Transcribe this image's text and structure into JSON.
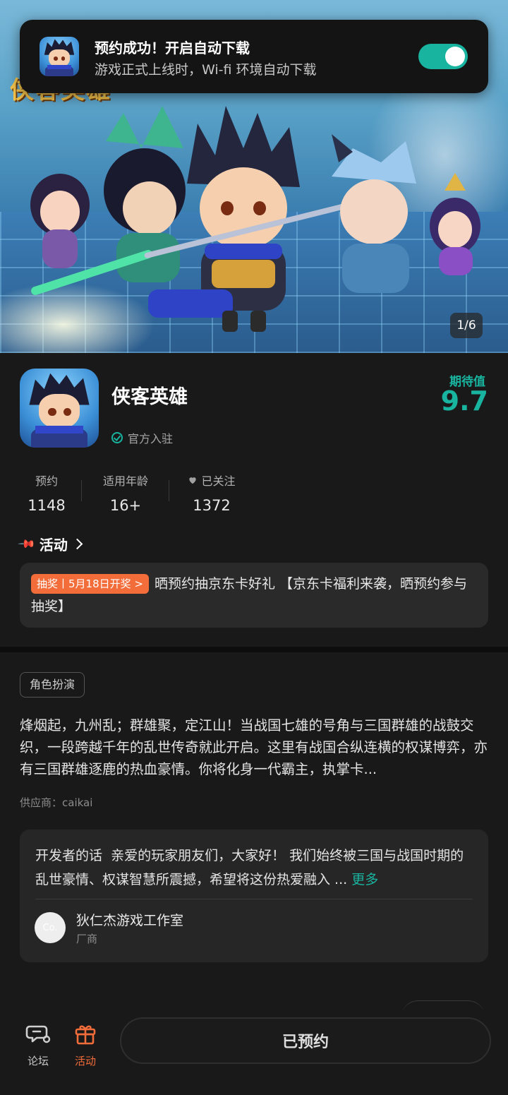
{
  "toast": {
    "title": "预约成功！开启自动下载",
    "subtitle": "游戏正式上线时，Wi-fi 环境自动下载",
    "toggle_on": true
  },
  "banner": {
    "logo_text": "侠客英雄",
    "counter": "1/6"
  },
  "app": {
    "name": "侠客英雄",
    "verified_label": "官方入驻",
    "expect_label": "期待值",
    "expect_value": "9.7"
  },
  "stats": [
    {
      "label": "预约",
      "value": "1148"
    },
    {
      "label": "适用年龄",
      "value": "16+"
    },
    {
      "label": "已关注",
      "value": "1372"
    }
  ],
  "activity": {
    "header": "活动",
    "badge": "抽奖丨5月18日开奖",
    "text": "晒预约抽京东卡好礼 【京东卡福利来袭，晒预约参与抽奖】"
  },
  "tag": "角色扮演",
  "description": "烽烟起，九州乱；群雄聚，定江山！当战国七雄的号角与三国群雄的战鼓交织，一段跨越千年的乱世传奇就此开启。这里有战国合纵连横的权谋博弈，亦有三国群雄逐鹿的热血豪情。你将化身一代霸主，执掌卡...",
  "supplier": "供应商：caikai",
  "developer": {
    "prefix": "开发者的话",
    "text": "亲爱的玩家朋友们，大家好！ 我们始终被三国与战国时期的乱世豪情、权谋智慧所震撼，希望将这份热爱融入 ...",
    "more": "更多",
    "avatar_text": "Co.",
    "name": "狄仁杰游戏工作室",
    "role": "厂商"
  },
  "bottom": {
    "forum": "论坛",
    "activity": "活动",
    "reserve": "已预约"
  },
  "colors": {
    "accent": "#19b49f",
    "badge": "#f26d3a",
    "nav_active": "#f26d3a"
  }
}
